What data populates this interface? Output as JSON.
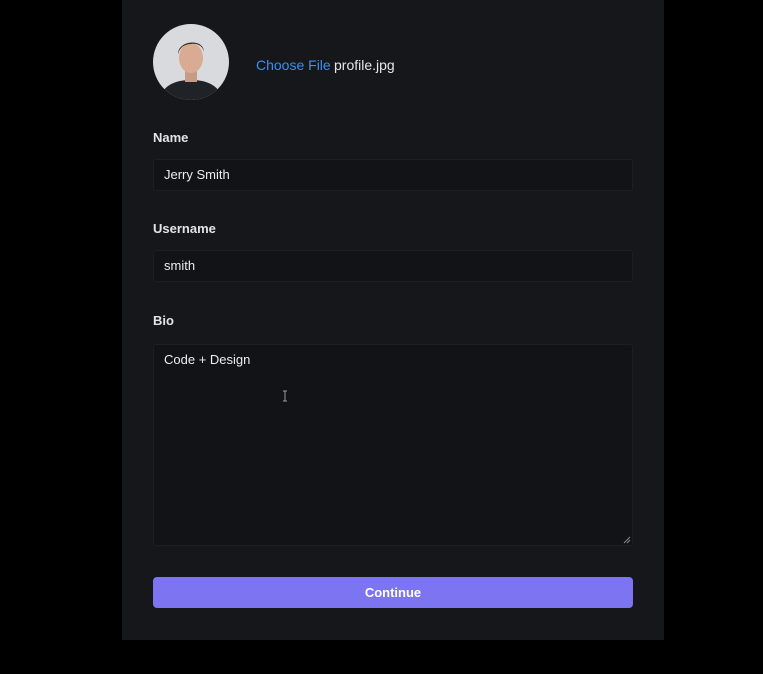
{
  "profile": {
    "choose_file_label": "Choose File",
    "file_name": "profile.jpg"
  },
  "form": {
    "name_label": "Name",
    "name_value": "Jerry Smith",
    "username_label": "Username",
    "username_value": "smith",
    "bio_label": "Bio",
    "bio_value": "Code + Design",
    "continue_label": "Continue"
  },
  "colors": {
    "accent": "#7c74f1",
    "link": "#3b8ef3",
    "panel": "#16171b",
    "background": "#000000"
  }
}
